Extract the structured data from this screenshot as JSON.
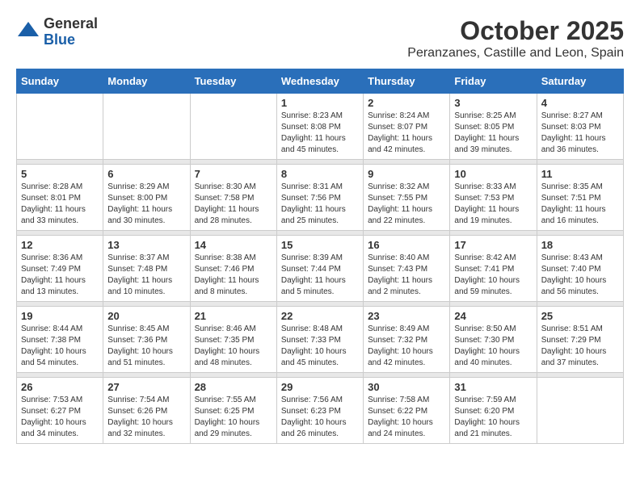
{
  "header": {
    "logo_general": "General",
    "logo_blue": "Blue",
    "title": "October 2025",
    "subtitle": "Peranzanes, Castille and Leon, Spain"
  },
  "days_of_week": [
    "Sunday",
    "Monday",
    "Tuesday",
    "Wednesday",
    "Thursday",
    "Friday",
    "Saturday"
  ],
  "weeks": [
    {
      "days": [
        {
          "number": "",
          "info": ""
        },
        {
          "number": "",
          "info": ""
        },
        {
          "number": "",
          "info": ""
        },
        {
          "number": "1",
          "info": "Sunrise: 8:23 AM\nSunset: 8:08 PM\nDaylight: 11 hours\nand 45 minutes."
        },
        {
          "number": "2",
          "info": "Sunrise: 8:24 AM\nSunset: 8:07 PM\nDaylight: 11 hours\nand 42 minutes."
        },
        {
          "number": "3",
          "info": "Sunrise: 8:25 AM\nSunset: 8:05 PM\nDaylight: 11 hours\nand 39 minutes."
        },
        {
          "number": "4",
          "info": "Sunrise: 8:27 AM\nSunset: 8:03 PM\nDaylight: 11 hours\nand 36 minutes."
        }
      ]
    },
    {
      "days": [
        {
          "number": "5",
          "info": "Sunrise: 8:28 AM\nSunset: 8:01 PM\nDaylight: 11 hours\nand 33 minutes."
        },
        {
          "number": "6",
          "info": "Sunrise: 8:29 AM\nSunset: 8:00 PM\nDaylight: 11 hours\nand 30 minutes."
        },
        {
          "number": "7",
          "info": "Sunrise: 8:30 AM\nSunset: 7:58 PM\nDaylight: 11 hours\nand 28 minutes."
        },
        {
          "number": "8",
          "info": "Sunrise: 8:31 AM\nSunset: 7:56 PM\nDaylight: 11 hours\nand 25 minutes."
        },
        {
          "number": "9",
          "info": "Sunrise: 8:32 AM\nSunset: 7:55 PM\nDaylight: 11 hours\nand 22 minutes."
        },
        {
          "number": "10",
          "info": "Sunrise: 8:33 AM\nSunset: 7:53 PM\nDaylight: 11 hours\nand 19 minutes."
        },
        {
          "number": "11",
          "info": "Sunrise: 8:35 AM\nSunset: 7:51 PM\nDaylight: 11 hours\nand 16 minutes."
        }
      ]
    },
    {
      "days": [
        {
          "number": "12",
          "info": "Sunrise: 8:36 AM\nSunset: 7:49 PM\nDaylight: 11 hours\nand 13 minutes."
        },
        {
          "number": "13",
          "info": "Sunrise: 8:37 AM\nSunset: 7:48 PM\nDaylight: 11 hours\nand 10 minutes."
        },
        {
          "number": "14",
          "info": "Sunrise: 8:38 AM\nSunset: 7:46 PM\nDaylight: 11 hours\nand 8 minutes."
        },
        {
          "number": "15",
          "info": "Sunrise: 8:39 AM\nSunset: 7:44 PM\nDaylight: 11 hours\nand 5 minutes."
        },
        {
          "number": "16",
          "info": "Sunrise: 8:40 AM\nSunset: 7:43 PM\nDaylight: 11 hours\nand 2 minutes."
        },
        {
          "number": "17",
          "info": "Sunrise: 8:42 AM\nSunset: 7:41 PM\nDaylight: 10 hours\nand 59 minutes."
        },
        {
          "number": "18",
          "info": "Sunrise: 8:43 AM\nSunset: 7:40 PM\nDaylight: 10 hours\nand 56 minutes."
        }
      ]
    },
    {
      "days": [
        {
          "number": "19",
          "info": "Sunrise: 8:44 AM\nSunset: 7:38 PM\nDaylight: 10 hours\nand 54 minutes."
        },
        {
          "number": "20",
          "info": "Sunrise: 8:45 AM\nSunset: 7:36 PM\nDaylight: 10 hours\nand 51 minutes."
        },
        {
          "number": "21",
          "info": "Sunrise: 8:46 AM\nSunset: 7:35 PM\nDaylight: 10 hours\nand 48 minutes."
        },
        {
          "number": "22",
          "info": "Sunrise: 8:48 AM\nSunset: 7:33 PM\nDaylight: 10 hours\nand 45 minutes."
        },
        {
          "number": "23",
          "info": "Sunrise: 8:49 AM\nSunset: 7:32 PM\nDaylight: 10 hours\nand 42 minutes."
        },
        {
          "number": "24",
          "info": "Sunrise: 8:50 AM\nSunset: 7:30 PM\nDaylight: 10 hours\nand 40 minutes."
        },
        {
          "number": "25",
          "info": "Sunrise: 8:51 AM\nSunset: 7:29 PM\nDaylight: 10 hours\nand 37 minutes."
        }
      ]
    },
    {
      "days": [
        {
          "number": "26",
          "info": "Sunrise: 7:53 AM\nSunset: 6:27 PM\nDaylight: 10 hours\nand 34 minutes."
        },
        {
          "number": "27",
          "info": "Sunrise: 7:54 AM\nSunset: 6:26 PM\nDaylight: 10 hours\nand 32 minutes."
        },
        {
          "number": "28",
          "info": "Sunrise: 7:55 AM\nSunset: 6:25 PM\nDaylight: 10 hours\nand 29 minutes."
        },
        {
          "number": "29",
          "info": "Sunrise: 7:56 AM\nSunset: 6:23 PM\nDaylight: 10 hours\nand 26 minutes."
        },
        {
          "number": "30",
          "info": "Sunrise: 7:58 AM\nSunset: 6:22 PM\nDaylight: 10 hours\nand 24 minutes."
        },
        {
          "number": "31",
          "info": "Sunrise: 7:59 AM\nSunset: 6:20 PM\nDaylight: 10 hours\nand 21 minutes."
        },
        {
          "number": "",
          "info": ""
        }
      ]
    }
  ]
}
